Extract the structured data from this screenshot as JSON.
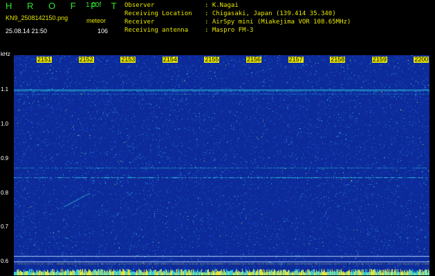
{
  "header": {
    "app_title": "H R O F F T",
    "version": "1.00f",
    "filename": "KN9_2508142150.png",
    "mode": "meteor",
    "datetime": "25.08.14 21:50",
    "count": "106"
  },
  "info": [
    {
      "label": "Observer",
      "value": ": K.Nagai"
    },
    {
      "label": "Receiving Location",
      "value": ": Chigasaki, Japan (139.414 35.340)"
    },
    {
      "label": "Receiver",
      "value": ": AirSpy mini (Miakejima VOR 108.65MHz)"
    },
    {
      "label": "Receiving antenna",
      "value": ": Maspro FM-3"
    }
  ],
  "spectrogram": {
    "freq_unit": "kHz",
    "freq_ticks": [
      "1.1",
      "1.0",
      "0.9",
      "0.8",
      "0.7",
      "0.6"
    ],
    "time_ticks": [
      "2151",
      "2152",
      "2153",
      "2154",
      "2155",
      "2156",
      "2157",
      "2158",
      "2159",
      "2200"
    ],
    "colors": {
      "background": "#0c2a9a",
      "noise": "#1b5ad6",
      "cyan": "#35e0e0",
      "yellow": "#f0f040"
    }
  }
}
